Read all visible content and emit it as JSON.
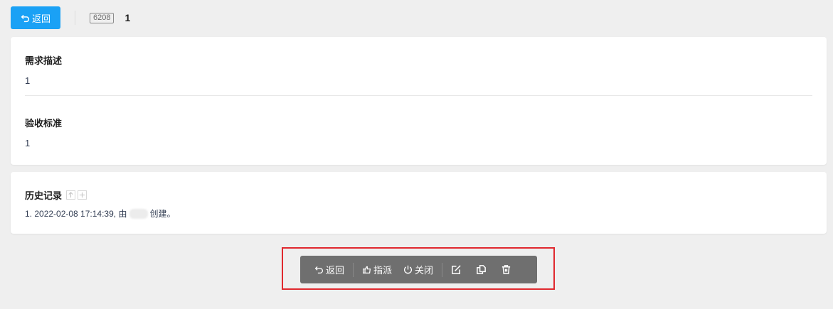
{
  "header": {
    "back_label": "返回",
    "story_id": "6208",
    "story_title": "1"
  },
  "description": {
    "title": "需求描述",
    "value": "1"
  },
  "acceptance": {
    "title": "验收标准",
    "value": "1"
  },
  "history": {
    "title": "历史记录",
    "items": [
      {
        "prefix": "1. 2022-02-08 17:14:39, 由",
        "suffix": "创建。"
      }
    ]
  },
  "toolbar": {
    "back_label": "返回",
    "assign_label": "指派",
    "close_label": "关闭",
    "icons": [
      "edit-icon",
      "copy-icon",
      "delete-icon"
    ]
  },
  "colors": {
    "primary": "#1aa1f5",
    "toolbar_bg": "#6f6f6f",
    "highlight": "#e0282e",
    "page_bg": "#efefef"
  }
}
